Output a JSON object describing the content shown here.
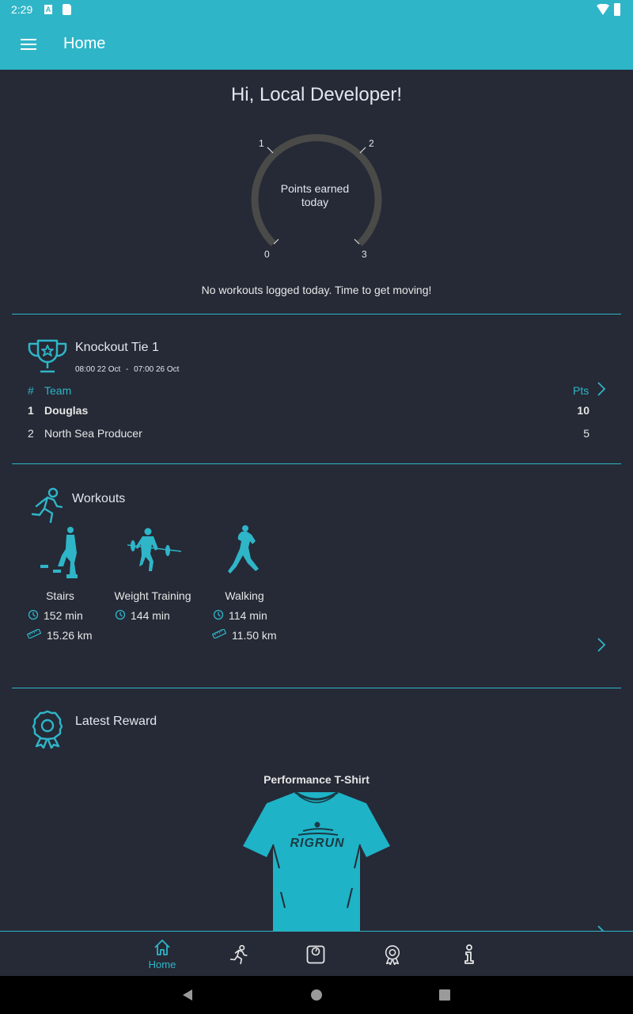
{
  "status_bar": {
    "time": "2:29",
    "icons": [
      "a-icon",
      "sd-card-icon",
      "wifi-icon",
      "battery-icon"
    ]
  },
  "app_bar": {
    "title": "Home",
    "menu_icon": "hamburger-menu-icon"
  },
  "greeting": "Hi, Local Developer!",
  "gauge": {
    "label": "Points earned today",
    "label_line1": "Points earned",
    "label_line2": "today",
    "min": 0,
    "max": 3,
    "value": 0,
    "ticks": [
      "0",
      "1",
      "2",
      "3"
    ],
    "track_color": "#4a4a48"
  },
  "no_workouts_message": "No workouts logged today. Time to get moving!",
  "competition": {
    "title": "Knockout Tie 1",
    "start": "08:00 22 Oct",
    "separator": "-",
    "end": "07:00 26 Oct",
    "columns": {
      "rank": "#",
      "team": "Team",
      "points": "Pts"
    },
    "rows": [
      {
        "rank": "1",
        "team": "Douglas",
        "points": "10",
        "bold": true
      },
      {
        "rank": "2",
        "team": "North Sea Producer",
        "points": "5",
        "bold": false
      }
    ]
  },
  "workouts": {
    "title": "Workouts",
    "items": [
      {
        "name": "Stairs",
        "duration": "152 min",
        "distance": "15.26 km"
      },
      {
        "name": "Weight Training",
        "duration": "144 min",
        "distance": ""
      },
      {
        "name": "Walking",
        "duration": "114 min",
        "distance": "11.50 km"
      }
    ]
  },
  "latest_reward": {
    "title": "Latest Reward",
    "item_name": "Performance T-Shirt",
    "shirt_brand": "RIGRUN"
  },
  "bottom_nav": {
    "items": [
      {
        "label": "Home",
        "icon": "home-icon",
        "active": true
      },
      {
        "label": "",
        "icon": "running-icon",
        "active": false
      },
      {
        "label": "",
        "icon": "scale-icon",
        "active": false
      },
      {
        "label": "",
        "icon": "award-icon",
        "active": false
      },
      {
        "label": "",
        "icon": "info-icon",
        "active": false
      }
    ]
  },
  "colors": {
    "accent": "#2fb5c8",
    "background": "#252a36",
    "shirt": "#1eb3c6"
  }
}
